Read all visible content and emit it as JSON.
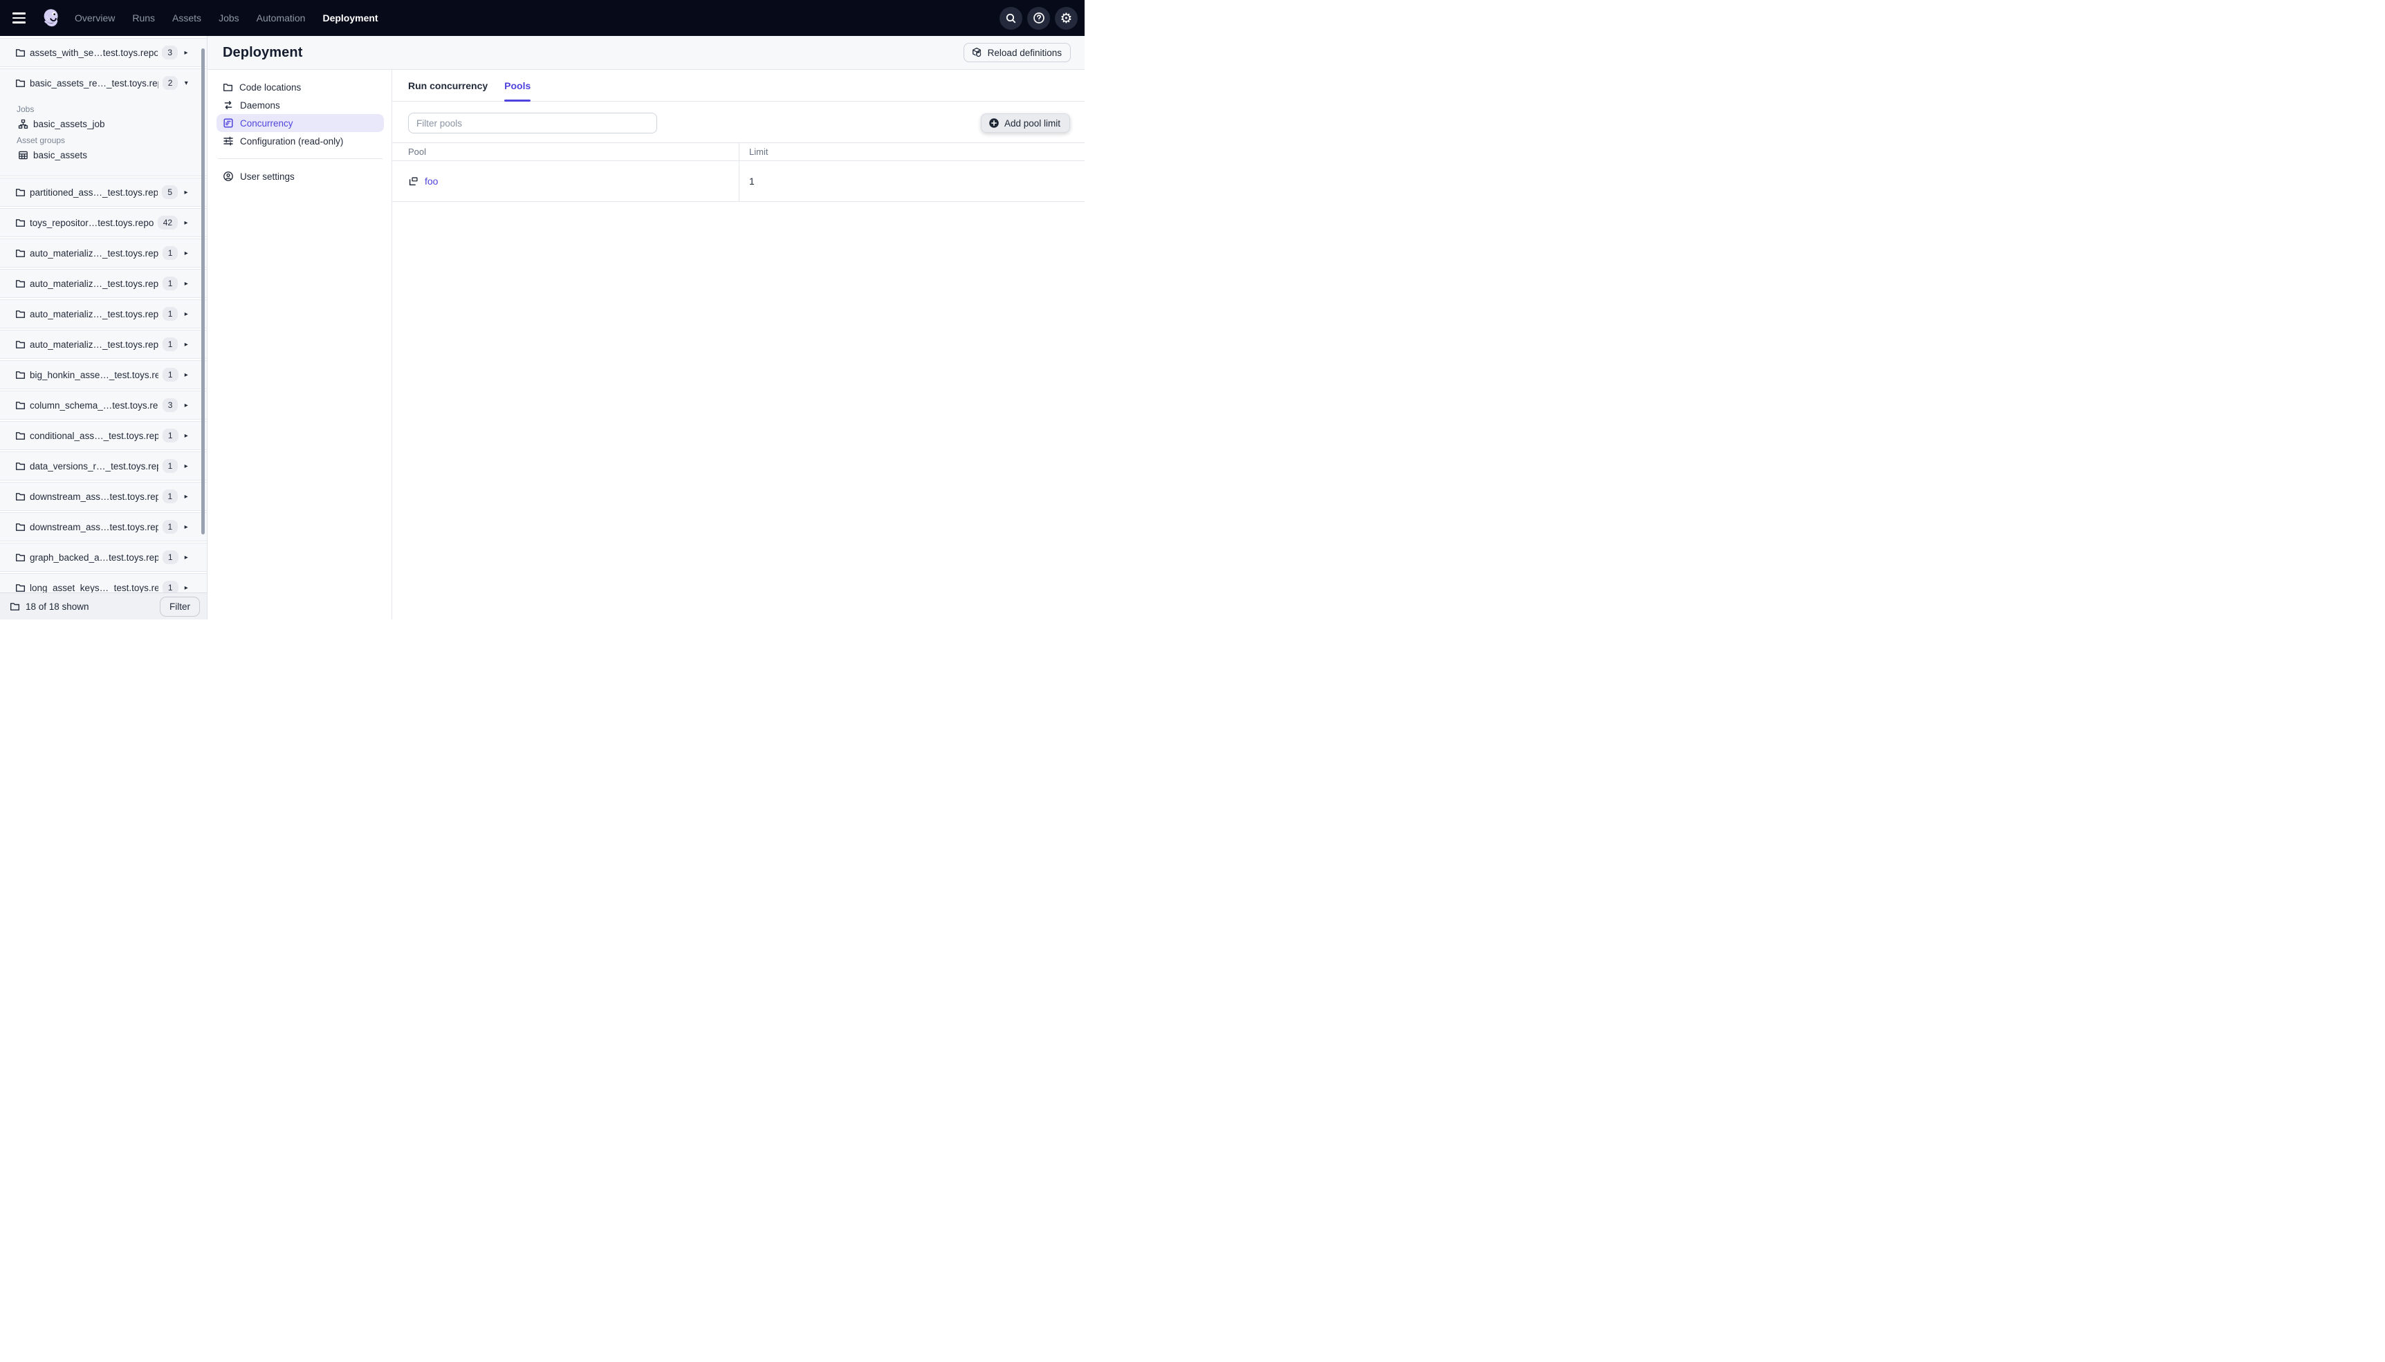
{
  "topnav": {
    "items": [
      {
        "label": "Overview",
        "active": false
      },
      {
        "label": "Runs",
        "active": false
      },
      {
        "label": "Assets",
        "active": false
      },
      {
        "label": "Jobs",
        "active": false
      },
      {
        "label": "Automation",
        "active": false
      },
      {
        "label": "Deployment",
        "active": true
      }
    ],
    "right_icons": [
      "search-icon",
      "help-icon",
      "gear-icon"
    ]
  },
  "sidebar": {
    "locations": [
      {
        "name": "assets_with_se…test.toys.repo",
        "badge": "3",
        "expanded": false
      },
      {
        "name": "basic_assets_re…_test.toys.rep",
        "badge": "2",
        "expanded": true,
        "sections": [
          {
            "label": "Jobs",
            "items": [
              {
                "type": "job",
                "name": "basic_assets_job"
              }
            ]
          },
          {
            "label": "Asset groups",
            "items": [
              {
                "type": "asset-group",
                "name": "basic_assets"
              }
            ]
          }
        ]
      },
      {
        "name": "partitioned_ass…_test.toys.rep",
        "badge": "5",
        "expanded": false
      },
      {
        "name": "toys_repositor…test.toys.repo",
        "badge": "42",
        "expanded": false
      },
      {
        "name": "auto_materializ…_test.toys.repo",
        "badge": "1",
        "expanded": false
      },
      {
        "name": "auto_materializ…_test.toys.repo",
        "badge": "1",
        "expanded": false
      },
      {
        "name": "auto_materializ…_test.toys.repo",
        "badge": "1",
        "expanded": false
      },
      {
        "name": "auto_materializ…_test.toys.repo",
        "badge": "1",
        "expanded": false
      },
      {
        "name": "big_honkin_asse…_test.toys.rep",
        "badge": "1",
        "expanded": false
      },
      {
        "name": "column_schema_…test.toys.rep",
        "badge": "3",
        "expanded": false
      },
      {
        "name": "conditional_ass…_test.toys.repo",
        "badge": "1",
        "expanded": false
      },
      {
        "name": "data_versions_r…_test.toys.rep",
        "badge": "1",
        "expanded": false
      },
      {
        "name": "downstream_ass…test.toys.rep",
        "badge": "1",
        "expanded": false
      },
      {
        "name": "downstream_ass…test.toys.rep",
        "badge": "1",
        "expanded": false
      },
      {
        "name": "graph_backed_a…test.toys.repo",
        "badge": "1",
        "expanded": false
      },
      {
        "name": "long_asset_keys…_test.toys.rep",
        "badge": "1",
        "expanded": false
      }
    ],
    "footer": {
      "summary": "18 of 18 shown",
      "filter_label": "Filter"
    }
  },
  "main": {
    "title": "Deployment",
    "reload_label": "Reload definitions",
    "nav": [
      {
        "label": "Code locations",
        "icon": "folder-icon",
        "active": false
      },
      {
        "label": "Daemons",
        "icon": "daemons-icon",
        "active": false
      },
      {
        "label": "Concurrency",
        "icon": "concurrency-icon",
        "active": true
      },
      {
        "label": "Configuration (read-only)",
        "icon": "sliders-icon",
        "active": false
      }
    ],
    "user_settings_label": "User settings",
    "tabs": [
      {
        "label": "Run concurrency",
        "active": false
      },
      {
        "label": "Pools",
        "active": true
      }
    ],
    "filter_placeholder": "Filter pools",
    "add_label": "Add pool limit",
    "table": {
      "columns": [
        "Pool",
        "Limit"
      ],
      "rows": [
        {
          "pool": "foo",
          "limit": "1"
        }
      ]
    }
  },
  "colors": {
    "topnav_bg": "#070B19",
    "accent": "#4F43DD",
    "accent_bg": "#E9E8FA",
    "row_bg": "#F7F8FA",
    "border": "#E3E6EB"
  }
}
